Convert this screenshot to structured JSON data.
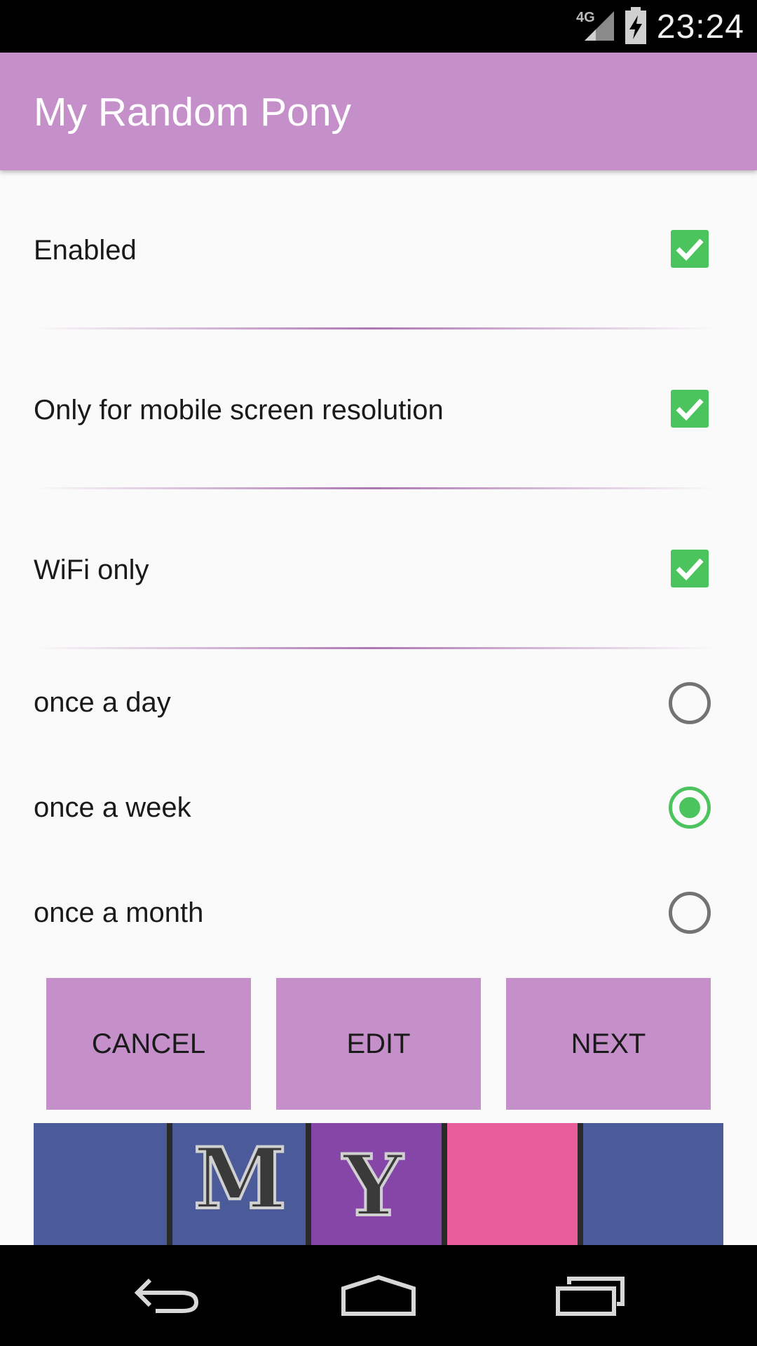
{
  "status_bar": {
    "time": "23:24",
    "network": "4G"
  },
  "app_bar": {
    "title": "My Random Pony"
  },
  "settings": [
    {
      "label": "Enabled",
      "checked": true
    },
    {
      "label": "Only for mobile screen resolution",
      "checked": true
    },
    {
      "label": "WiFi only",
      "checked": true
    }
  ],
  "frequency": {
    "options": [
      {
        "label": "once a day",
        "selected": false
      },
      {
        "label": "once a week",
        "selected": true
      },
      {
        "label": "once a month",
        "selected": false
      }
    ]
  },
  "buttons": {
    "cancel": "CANCEL",
    "edit": "EDIT",
    "next": "NEXT"
  },
  "banner": {
    "letters": [
      "M",
      "Y"
    ]
  },
  "colors": {
    "accent": "#c590ca",
    "check_green": "#4cc45d",
    "banner_blue": "#4b5a99",
    "banner_purple": "#8546a8",
    "banner_pink": "#e85d9a"
  }
}
